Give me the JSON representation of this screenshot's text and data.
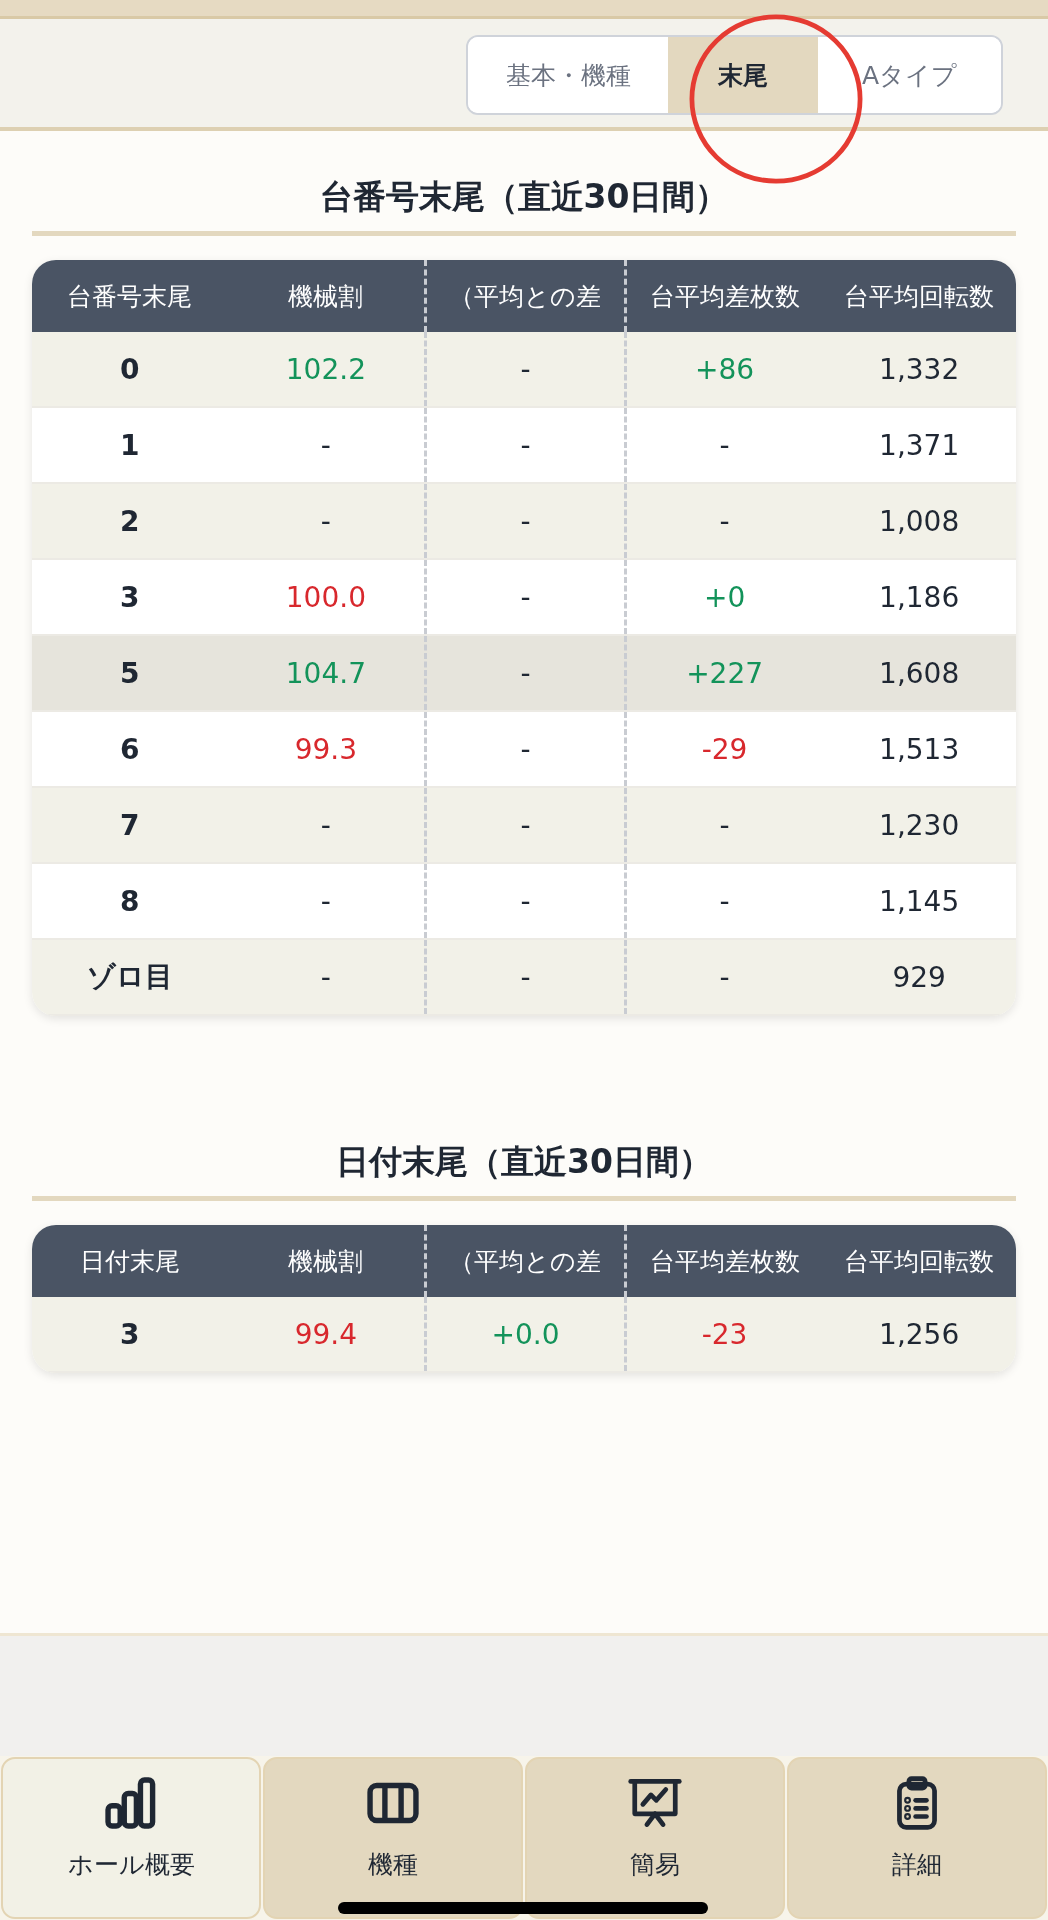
{
  "tabs": [
    {
      "label": "基本・機種",
      "selected": false
    },
    {
      "label": "末尾",
      "selected": true
    },
    {
      "label": "Aタイプ",
      "selected": false
    }
  ],
  "annotation": {
    "kind": "circle"
  },
  "sections": [
    {
      "title": "台番号末尾（直近30日間）",
      "columns": [
        "台番号末尾",
        "機械割",
        "（平均との差",
        "台平均差枚数",
        "台平均回転数"
      ],
      "rows": [
        {
          "highlighted": false,
          "cells": [
            {
              "text": "0",
              "color": "#1f2733"
            },
            {
              "text": "102.2",
              "color": "#13935a"
            },
            {
              "text": "-",
              "color": "#1f2733"
            },
            {
              "text": "+86",
              "color": "#13935a"
            },
            {
              "text": "1,332",
              "color": "#1f2733"
            }
          ]
        },
        {
          "highlighted": false,
          "cells": [
            {
              "text": "1",
              "color": "#1f2733"
            },
            {
              "text": "-",
              "color": "#1f2733"
            },
            {
              "text": "-",
              "color": "#1f2733"
            },
            {
              "text": "-",
              "color": "#1f2733"
            },
            {
              "text": "1,371",
              "color": "#1f2733"
            }
          ]
        },
        {
          "highlighted": false,
          "cells": [
            {
              "text": "2",
              "color": "#1f2733"
            },
            {
              "text": "-",
              "color": "#1f2733"
            },
            {
              "text": "-",
              "color": "#1f2733"
            },
            {
              "text": "-",
              "color": "#1f2733"
            },
            {
              "text": "1,008",
              "color": "#1f2733"
            }
          ]
        },
        {
          "highlighted": false,
          "cells": [
            {
              "text": "3",
              "color": "#1f2733"
            },
            {
              "text": "100.0",
              "color": "#d8282d"
            },
            {
              "text": "-",
              "color": "#1f2733"
            },
            {
              "text": "+0",
              "color": "#13935a"
            },
            {
              "text": "1,186",
              "color": "#1f2733"
            }
          ]
        },
        {
          "highlighted": true,
          "cells": [
            {
              "text": "5",
              "color": "#1f2733"
            },
            {
              "text": "104.7",
              "color": "#13935a"
            },
            {
              "text": "-",
              "color": "#1f2733"
            },
            {
              "text": "+227",
              "color": "#13935a"
            },
            {
              "text": "1,608",
              "color": "#1f2733"
            }
          ]
        },
        {
          "highlighted": false,
          "cells": [
            {
              "text": "6",
              "color": "#1f2733"
            },
            {
              "text": "99.3",
              "color": "#d8282d"
            },
            {
              "text": "-",
              "color": "#1f2733"
            },
            {
              "text": "-29",
              "color": "#d8282d"
            },
            {
              "text": "1,513",
              "color": "#1f2733"
            }
          ]
        },
        {
          "highlighted": false,
          "cells": [
            {
              "text": "7",
              "color": "#1f2733"
            },
            {
              "text": "-",
              "color": "#1f2733"
            },
            {
              "text": "-",
              "color": "#1f2733"
            },
            {
              "text": "-",
              "color": "#1f2733"
            },
            {
              "text": "1,230",
              "color": "#1f2733"
            }
          ]
        },
        {
          "highlighted": false,
          "cells": [
            {
              "text": "8",
              "color": "#1f2733"
            },
            {
              "text": "-",
              "color": "#1f2733"
            },
            {
              "text": "-",
              "color": "#1f2733"
            },
            {
              "text": "-",
              "color": "#1f2733"
            },
            {
              "text": "1,145",
              "color": "#1f2733"
            }
          ]
        },
        {
          "highlighted": false,
          "cells": [
            {
              "text": "ゾロ目",
              "color": "#1f2733"
            },
            {
              "text": "-",
              "color": "#1f2733"
            },
            {
              "text": "-",
              "color": "#1f2733"
            },
            {
              "text": "-",
              "color": "#1f2733"
            },
            {
              "text": "929",
              "color": "#1f2733"
            }
          ]
        }
      ]
    },
    {
      "title": "日付末尾（直近30日間）",
      "columns": [
        "日付末尾",
        "機械割",
        "（平均との差",
        "台平均差枚数",
        "台平均回転数"
      ],
      "rows": [
        {
          "highlighted": false,
          "cells": [
            {
              "text": "3",
              "color": "#1f2733"
            },
            {
              "text": "99.4",
              "color": "#d8282d"
            },
            {
              "text": "+0.0",
              "color": "#13935a"
            },
            {
              "text": "-23",
              "color": "#d8282d"
            },
            {
              "text": "1,256",
              "color": "#1f2733"
            }
          ]
        }
      ]
    }
  ],
  "nav": [
    {
      "label": "ホール概要",
      "kind": "bars",
      "selected": true
    },
    {
      "label": "機種",
      "kind": "columns",
      "selected": false
    },
    {
      "label": "簡易",
      "kind": "presentation",
      "selected": false
    },
    {
      "label": "詳細",
      "kind": "clipboard",
      "selected": false
    }
  ]
}
